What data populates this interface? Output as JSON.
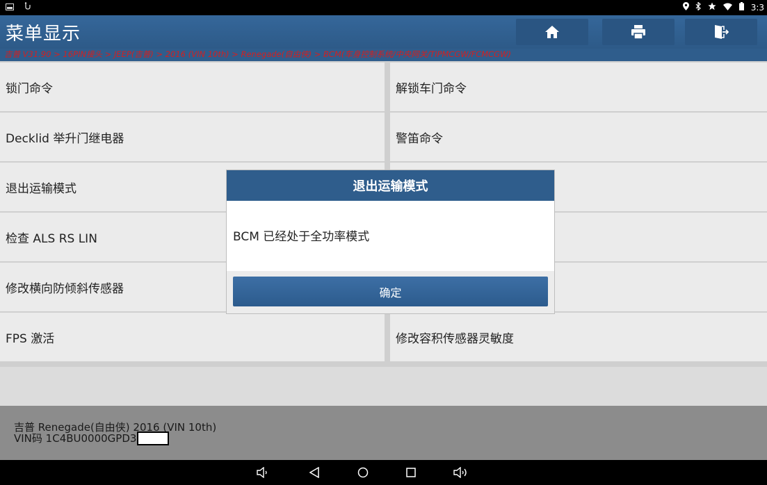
{
  "status_bar": {
    "icons_left": [
      "image-icon",
      "usb-icon"
    ],
    "icons_right": [
      "location-icon",
      "bluetooth-icon",
      "star-icon",
      "wifi-icon",
      "battery-icon"
    ],
    "time": "3:3"
  },
  "app_bar": {
    "title": "菜单显示",
    "buttons": [
      "home-icon",
      "print-icon",
      "exit-icon"
    ]
  },
  "breadcrumb": "吉普 V31.90 > 16PIN接头 > JEEP(吉普) > 2016 (VIN 10th) > Renegade(自由侠) > BCM(车身控制系统/中央网关/TIPMCGW/FCMCGW)",
  "menu": {
    "left": [
      "锁门命令",
      "Decklid 举升门继电器",
      "退出运输模式",
      "检查 ALS RS LIN",
      "修改横向防倾斜传感器",
      "FPS 激活"
    ],
    "right": [
      "解锁车门命令",
      "警笛命令",
      "",
      "",
      "",
      "修改容积传感器灵敏度"
    ]
  },
  "footer": {
    "vehicle": "吉普 Renegade(自由侠) 2016 (VIN 10th)",
    "vin": "VIN码 1C4BU0000GPD3"
  },
  "dialog": {
    "title": "退出运输模式",
    "message": "BCM 已经处于全功率模式",
    "ok_label": "确定"
  },
  "colors": {
    "header_blue": "#2f5d8c",
    "breadcrumb_red": "#d32020",
    "cell_bg": "#ebebeb",
    "footer_bg": "#8c8c8c"
  }
}
